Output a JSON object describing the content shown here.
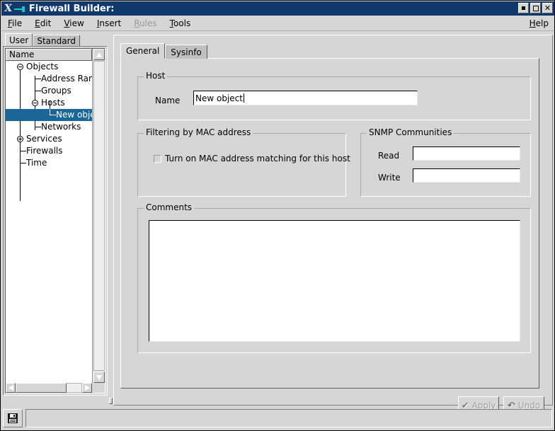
{
  "window": {
    "title": "Firewall Builder:",
    "logo_icon": "x-logo-icon",
    "wm_icon": "window-manager-icon",
    "minimize_label": "",
    "maximize_label": "",
    "close_label": "✕"
  },
  "menubar": {
    "items": [
      {
        "label": "File",
        "mnemonic": "F",
        "rest": "ile",
        "disabled": false
      },
      {
        "label": "Edit",
        "mnemonic": "E",
        "rest": "dit",
        "disabled": false
      },
      {
        "label": "View",
        "mnemonic": "V",
        "rest": "iew",
        "disabled": false
      },
      {
        "label": "Insert",
        "mnemonic": "I",
        "rest": "nsert",
        "disabled": false
      },
      {
        "label": "Rules",
        "mnemonic": "R",
        "rest": "ules",
        "disabled": true
      },
      {
        "label": "Tools",
        "mnemonic": "T",
        "rest": "ools",
        "disabled": false
      }
    ],
    "help": {
      "label": "Help",
      "mnemonic": "H",
      "rest": "elp"
    }
  },
  "library_tabs": [
    {
      "label": "User",
      "active": true
    },
    {
      "label": "Standard",
      "active": false
    }
  ],
  "tree": {
    "column_header": "Name",
    "nodes": [
      {
        "label": "Objects",
        "state": "expanded"
      },
      {
        "label": "Address Range",
        "state": "leaf"
      },
      {
        "label": "Groups",
        "state": "leaf"
      },
      {
        "label": "Hosts",
        "state": "expanded"
      },
      {
        "label": "New object",
        "state": "leaf",
        "selected": true
      },
      {
        "label": "Networks",
        "state": "leaf"
      },
      {
        "label": "Services",
        "state": "collapsed"
      },
      {
        "label": "Firewalls",
        "state": "leaf"
      },
      {
        "label": "Time",
        "state": "leaf"
      }
    ]
  },
  "object_tabs": [
    {
      "label": "General",
      "active": true
    },
    {
      "label": "Sysinfo",
      "active": false
    }
  ],
  "host_group": {
    "title": "Host",
    "name_label": "Name",
    "name_value": "New object"
  },
  "mac_group": {
    "title": "Filtering by MAC address",
    "checkbox_label": "Turn on MAC address matching for this host",
    "checked": false
  },
  "snmp_group": {
    "title": "SNMP Communities",
    "read_label": "Read",
    "read_value": "",
    "write_label": "Write",
    "write_value": ""
  },
  "comments_group": {
    "title": "Comments",
    "value": ""
  },
  "buttons": {
    "apply": {
      "label": "Apply",
      "icon": "checkmark-icon",
      "glyph": "✔",
      "disabled": true
    },
    "undo": {
      "label": "Undo",
      "icon": "undo-arrow-icon",
      "glyph": "↶",
      "disabled": true
    }
  },
  "statusbar": {
    "icon": "save-floppy-icon",
    "message": ""
  },
  "colors": {
    "titlebar": "#10386b",
    "face": "#d6d6d6",
    "selection": "#1a6699",
    "field": "#ffffff",
    "disabled_text": "#9a9a9a"
  }
}
